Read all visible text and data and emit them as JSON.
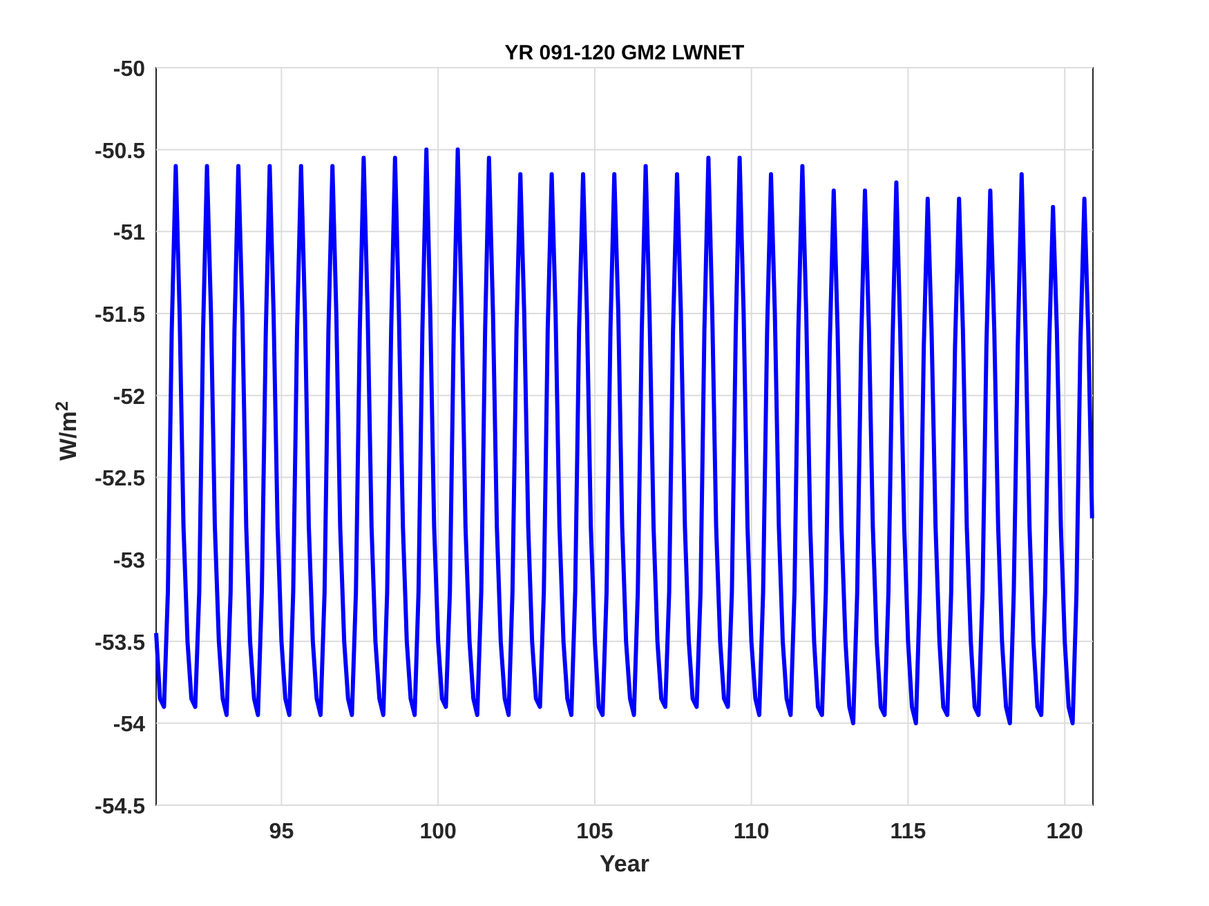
{
  "figure": {
    "chart_data": {
      "type": "line",
      "title": "YR 091-120 GM2 LWNET",
      "xlabel": "Year",
      "ylabel": "W/m$^{2}$",
      "xlim": [
        91,
        120.9
      ],
      "ylim": [
        -54.5,
        -50
      ],
      "grid": true,
      "xticks": [
        95,
        100,
        105,
        110,
        115,
        120
      ],
      "yticks": [
        -54.5,
        -54,
        -53.5,
        -53,
        -52.5,
        -52,
        -51.5,
        -51,
        -50.5,
        -50
      ],
      "x": [
        91,
        91.125,
        91.25,
        91.375,
        91.5,
        91.625,
        91.75,
        91.875,
        92,
        92.125,
        92.25,
        92.375,
        92.5,
        92.625,
        92.75,
        92.875,
        93,
        93.125,
        93.25,
        93.375,
        93.5,
        93.625,
        93.75,
        93.875,
        94,
        94.125,
        94.25,
        94.375,
        94.5,
        94.625,
        94.75,
        94.875,
        95,
        95.125,
        95.25,
        95.375,
        95.5,
        95.625,
        95.75,
        95.875,
        96,
        96.125,
        96.25,
        96.375,
        96.5,
        96.625,
        96.75,
        96.875,
        97,
        97.125,
        97.25,
        97.375,
        97.5,
        97.625,
        97.75,
        97.875,
        98,
        98.125,
        98.25,
        98.375,
        98.5,
        98.625,
        98.75,
        98.875,
        99,
        99.125,
        99.25,
        99.375,
        99.5,
        99.625,
        99.75,
        99.875,
        100,
        100.125,
        100.25,
        100.375,
        100.5,
        100.625,
        100.75,
        100.875,
        101,
        101.125,
        101.25,
        101.375,
        101.5,
        101.625,
        101.75,
        101.875,
        102,
        102.125,
        102.25,
        102.375,
        102.5,
        102.625,
        102.75,
        102.875,
        103,
        103.125,
        103.25,
        103.375,
        103.5,
        103.625,
        103.75,
        103.875,
        104,
        104.125,
        104.25,
        104.375,
        104.5,
        104.625,
        104.75,
        104.875,
        105,
        105.125,
        105.25,
        105.375,
        105.5,
        105.625,
        105.75,
        105.875,
        106,
        106.125,
        106.25,
        106.375,
        106.5,
        106.625,
        106.75,
        106.875,
        107,
        107.125,
        107.25,
        107.375,
        107.5,
        107.625,
        107.75,
        107.875,
        108,
        108.125,
        108.25,
        108.375,
        108.5,
        108.625,
        108.75,
        108.875,
        109,
        109.125,
        109.25,
        109.375,
        109.5,
        109.625,
        109.75,
        109.875,
        110,
        110.125,
        110.25,
        110.375,
        110.5,
        110.625,
        110.75,
        110.875,
        111,
        111.125,
        111.25,
        111.375,
        111.5,
        111.625,
        111.75,
        111.875,
        112,
        112.125,
        112.25,
        112.375,
        112.5,
        112.625,
        112.75,
        112.875,
        113,
        113.125,
        113.25,
        113.375,
        113.5,
        113.625,
        113.75,
        113.875,
        114,
        114.125,
        114.25,
        114.375,
        114.5,
        114.625,
        114.75,
        114.875,
        115,
        115.125,
        115.25,
        115.375,
        115.5,
        115.625,
        115.75,
        115.875,
        116,
        116.125,
        116.25,
        116.375,
        116.5,
        116.625,
        116.75,
        116.875,
        117,
        117.125,
        117.25,
        117.375,
        117.5,
        117.625,
        117.75,
        117.875,
        118,
        118.125,
        118.25,
        118.375,
        118.5,
        118.625,
        118.75,
        118.875,
        119,
        119.125,
        119.25,
        119.375,
        119.5,
        119.625,
        119.75,
        119.875,
        120,
        120.125,
        120.25,
        120.375,
        120.5,
        120.625,
        120.75,
        120.875
      ],
      "series": [
        {
          "color": "#0000ff",
          "values": [
            -53.45,
            -53.85,
            -53.9,
            -53.2,
            -51.6,
            -50.6,
            -51.5,
            -52.8,
            -53.5,
            -53.85,
            -53.9,
            -53.2,
            -51.6,
            -50.6,
            -51.5,
            -52.8,
            -53.5,
            -53.85,
            -53.95,
            -53.2,
            -51.6,
            -50.6,
            -51.5,
            -52.8,
            -53.5,
            -53.85,
            -53.95,
            -53.2,
            -51.6,
            -50.6,
            -51.5,
            -52.8,
            -53.5,
            -53.85,
            -53.95,
            -53.2,
            -51.6,
            -50.6,
            -51.5,
            -52.8,
            -53.5,
            -53.85,
            -53.95,
            -53.2,
            -51.6,
            -50.6,
            -51.5,
            -52.8,
            -53.5,
            -53.85,
            -53.95,
            -53.2,
            -51.6,
            -50.55,
            -51.5,
            -52.8,
            -53.5,
            -53.85,
            -53.95,
            -53.2,
            -51.6,
            -50.55,
            -51.5,
            -52.8,
            -53.5,
            -53.85,
            -53.95,
            -53.2,
            -51.6,
            -50.5,
            -51.5,
            -52.8,
            -53.5,
            -53.85,
            -53.9,
            -53.2,
            -51.6,
            -50.5,
            -51.5,
            -52.8,
            -53.5,
            -53.85,
            -53.95,
            -53.2,
            -51.6,
            -50.55,
            -51.5,
            -52.8,
            -53.5,
            -53.85,
            -53.95,
            -53.2,
            -51.6,
            -50.65,
            -51.5,
            -52.8,
            -53.5,
            -53.85,
            -53.9,
            -53.2,
            -51.6,
            -50.65,
            -51.5,
            -52.8,
            -53.5,
            -53.85,
            -53.95,
            -53.2,
            -51.6,
            -50.65,
            -51.5,
            -52.8,
            -53.5,
            -53.9,
            -53.95,
            -53.2,
            -51.6,
            -50.65,
            -51.5,
            -52.8,
            -53.5,
            -53.85,
            -53.95,
            -53.2,
            -51.6,
            -50.6,
            -51.5,
            -52.8,
            -53.5,
            -53.85,
            -53.9,
            -53.2,
            -51.6,
            -50.65,
            -51.5,
            -52.8,
            -53.5,
            -53.85,
            -53.9,
            -53.2,
            -51.6,
            -50.55,
            -51.5,
            -52.8,
            -53.5,
            -53.85,
            -53.9,
            -53.2,
            -51.6,
            -50.55,
            -51.5,
            -52.8,
            -53.5,
            -53.85,
            -53.95,
            -53.2,
            -51.6,
            -50.65,
            -51.5,
            -52.8,
            -53.5,
            -53.85,
            -53.95,
            -53.2,
            -51.6,
            -50.6,
            -51.5,
            -52.8,
            -53.5,
            -53.9,
            -53.95,
            -53.2,
            -51.7,
            -50.75,
            -51.6,
            -52.8,
            -53.5,
            -53.9,
            -54,
            -53.2,
            -51.7,
            -50.75,
            -51.6,
            -52.8,
            -53.5,
            -53.9,
            -53.95,
            -53.2,
            -51.7,
            -50.7,
            -51.6,
            -52.8,
            -53.5,
            -53.9,
            -54,
            -53.2,
            -51.7,
            -50.8,
            -51.6,
            -52.8,
            -53.5,
            -53.9,
            -53.95,
            -53.2,
            -51.7,
            -50.8,
            -51.6,
            -52.8,
            -53.5,
            -53.9,
            -53.95,
            -53.2,
            -51.7,
            -50.75,
            -51.6,
            -52.8,
            -53.5,
            -53.9,
            -54,
            -53.2,
            -51.7,
            -50.65,
            -51.6,
            -52.8,
            -53.5,
            -53.9,
            -53.95,
            -53.2,
            -51.7,
            -50.85,
            -51.6,
            -52.8,
            -53.5,
            -53.9,
            -54,
            -53.2,
            -51.7,
            -50.8,
            -51.6,
            -52.75
          ]
        }
      ]
    }
  }
}
